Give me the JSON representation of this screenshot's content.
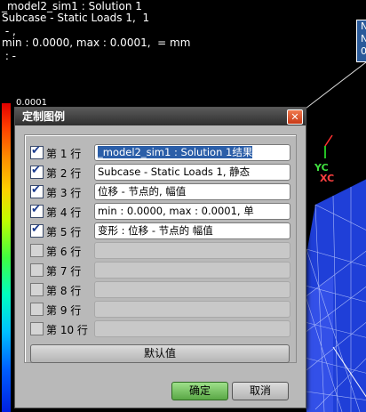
{
  "viewport": {
    "info_lines": [
      "_model2_sim1 : Solution 1",
      "Subcase - Static Loads 1,  1",
      " - ,",
      "min : 0.0000, max : 0.0001,  = mm",
      " : -"
    ],
    "colorbar_top_label": "0.0001",
    "info_box": [
      "N",
      "N",
      "0."
    ],
    "axis_yc": "YC",
    "axis_xc": "XC"
  },
  "dialog": {
    "title": "定制图例",
    "close_glyph": "✕",
    "rows": [
      {
        "label": "第 1 行",
        "checked": true,
        "value": "_model2_sim1 : Solution 1结果",
        "selected": true
      },
      {
        "label": "第 2 行",
        "checked": true,
        "value": "Subcase - Static Loads 1, 静态"
      },
      {
        "label": "第 3 行",
        "checked": true,
        "value": "位移 - 节点的, 幅值"
      },
      {
        "label": "第 4 行",
        "checked": true,
        "value": "min : 0.0000, max : 0.0001, 单"
      },
      {
        "label": "第 5 行",
        "checked": true,
        "value": "变形 : 位移 - 节点的 幅值"
      },
      {
        "label": "第 6 行",
        "checked": false,
        "value": ""
      },
      {
        "label": "第 7 行",
        "checked": false,
        "value": ""
      },
      {
        "label": "第 8 行",
        "checked": false,
        "value": ""
      },
      {
        "label": "第 9 行",
        "checked": false,
        "value": ""
      },
      {
        "label": "第 10 行",
        "checked": false,
        "value": ""
      }
    ],
    "default_button": "默认值",
    "ok_button": "确定",
    "cancel_button": "取消"
  }
}
